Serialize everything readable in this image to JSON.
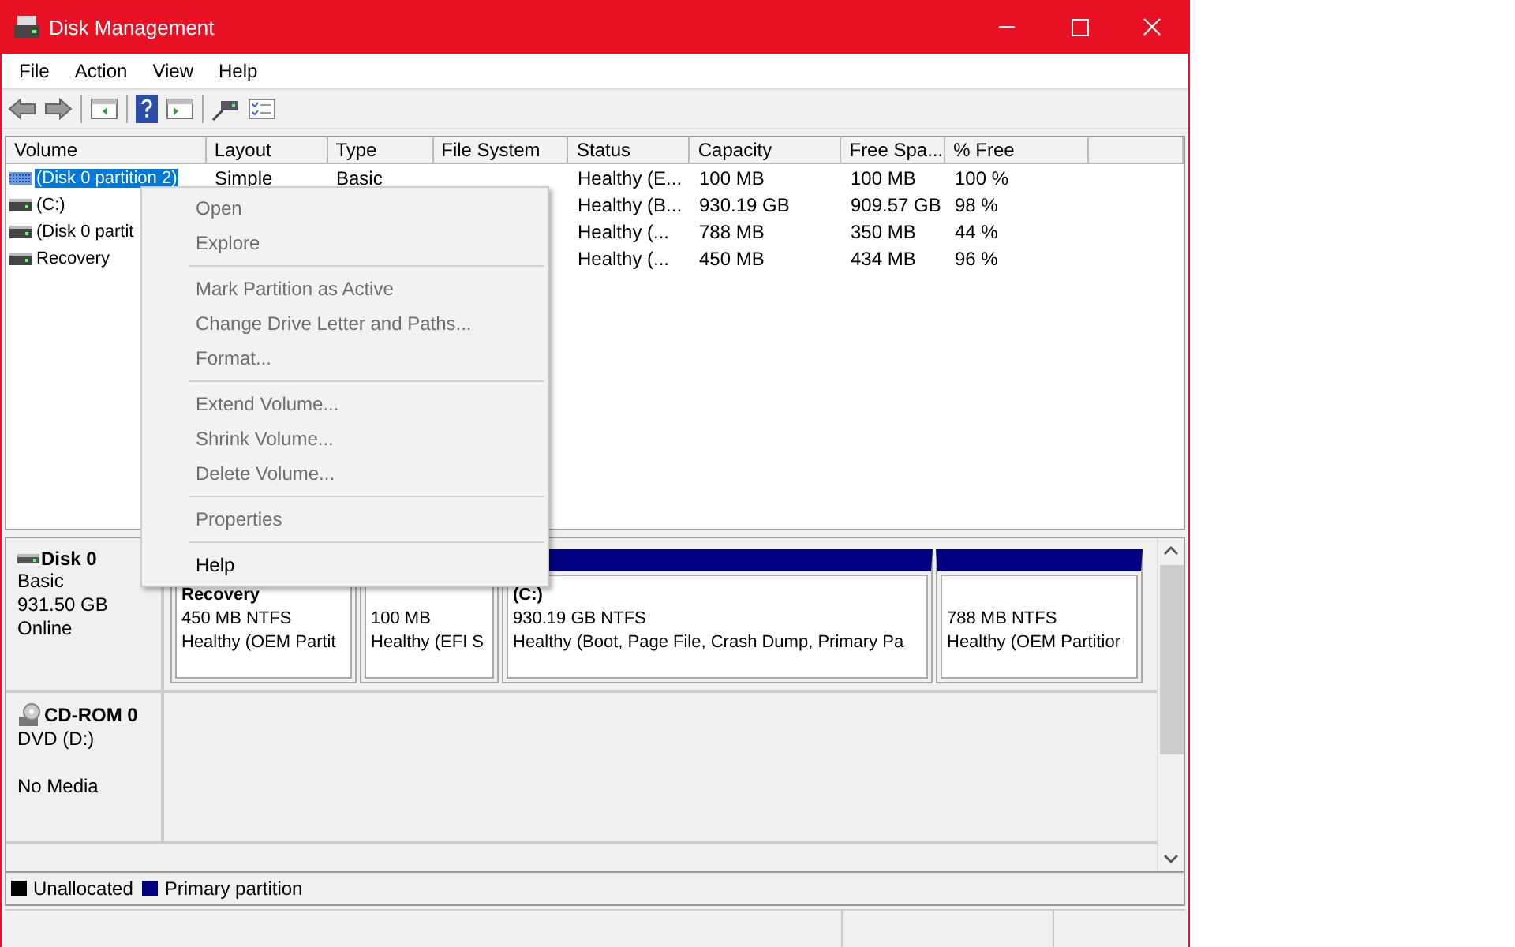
{
  "window": {
    "title": "Disk Management"
  },
  "menu_bar": [
    "File",
    "Action",
    "View",
    "Help"
  ],
  "volume_table": {
    "columns": [
      "Volume",
      "Layout",
      "Type",
      "File System",
      "Status",
      "Capacity",
      "Free Spa...",
      "% Free"
    ],
    "rows": [
      {
        "kind": "striped",
        "selected": true,
        "cells": [
          "(Disk 0 partition 2)",
          "Simple",
          "Basic",
          null,
          "Healthy (E...",
          "100 MB",
          "100 MB",
          "100 %"
        ]
      },
      {
        "kind": "drive",
        "selected": false,
        "cells": [
          "(C:)",
          null,
          null,
          null,
          "Healthy (B...",
          "930.19 GB",
          "909.57 GB",
          "98 %"
        ]
      },
      {
        "kind": "drive",
        "selected": false,
        "cells": [
          "(Disk 0 partit",
          null,
          null,
          null,
          "Healthy (...",
          "788 MB",
          "350 MB",
          "44 %"
        ]
      },
      {
        "kind": "drive",
        "selected": false,
        "cells": [
          "Recovery",
          null,
          null,
          null,
          "Healthy (...",
          "450 MB",
          "434 MB",
          "96 %"
        ]
      }
    ]
  },
  "context_menu": [
    {
      "kind": "item",
      "label": "Open",
      "disabled": true
    },
    {
      "kind": "item",
      "label": "Explore",
      "disabled": true
    },
    {
      "kind": "separator"
    },
    {
      "kind": "item",
      "label": "Mark Partition as Active",
      "disabled": true
    },
    {
      "kind": "item",
      "label": "Change Drive Letter and Paths...",
      "disabled": true
    },
    {
      "kind": "item",
      "label": "Format...",
      "disabled": true
    },
    {
      "kind": "separator"
    },
    {
      "kind": "item",
      "label": "Extend Volume...",
      "disabled": true
    },
    {
      "kind": "item",
      "label": "Shrink Volume...",
      "disabled": true
    },
    {
      "kind": "item",
      "label": "Delete Volume...",
      "disabled": true
    },
    {
      "kind": "separator"
    },
    {
      "kind": "item",
      "label": "Properties",
      "disabled": true
    },
    {
      "kind": "separator"
    },
    {
      "kind": "item",
      "label": "Help",
      "disabled": false
    }
  ],
  "disks": [
    {
      "kind": "disk",
      "name": "Disk 0",
      "lines": [
        "Basic",
        "931.50 GB",
        "Online"
      ],
      "partitions": [
        {
          "label": "Recovery",
          "size": "450 MB NTFS",
          "status": "Healthy (OEM Partit"
        },
        {
          "size": "100 MB",
          "status": "Healthy (EFI S"
        },
        {
          "label": "(C:)",
          "size": "930.19 GB NTFS",
          "status": "Healthy (Boot, Page File, Crash Dump, Primary Pa"
        },
        {
          "size": "788 MB NTFS",
          "status": "Healthy (OEM Partitior"
        }
      ]
    },
    {
      "kind": "cdrom",
      "name": "CD-ROM 0",
      "lines": [
        "DVD (D:)",
        "No Media"
      ]
    }
  ],
  "legend": [
    {
      "label": "Unallocated",
      "color": "#000000"
    },
    {
      "label": "Primary partition",
      "color": "#000080"
    }
  ]
}
